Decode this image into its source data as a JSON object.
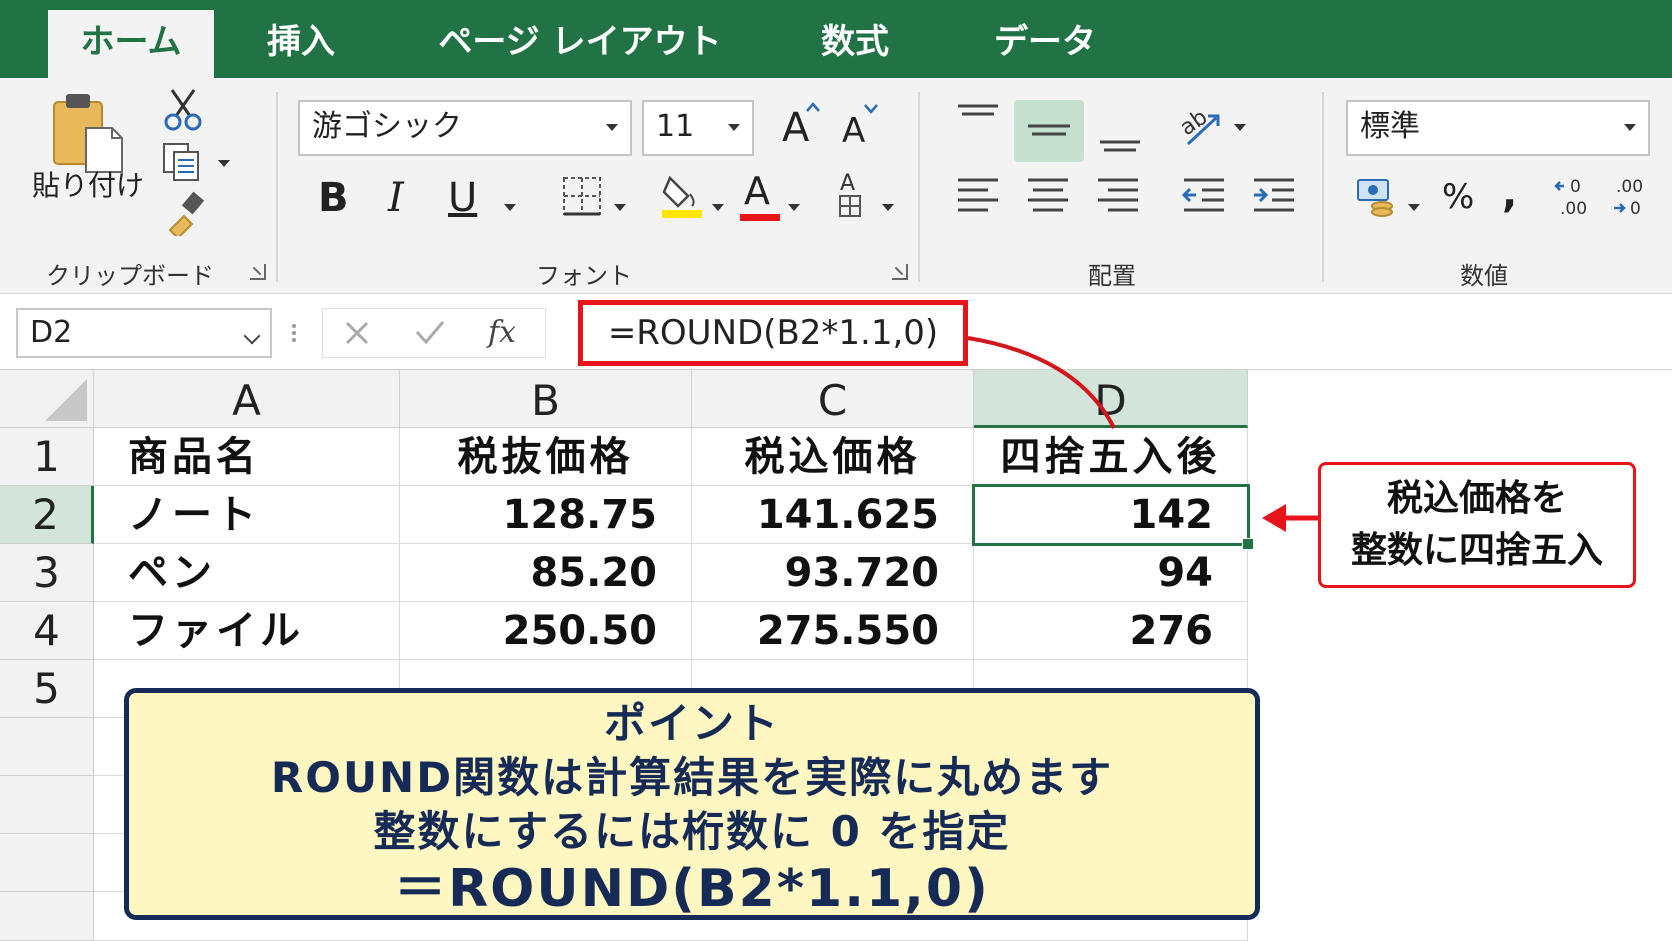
{
  "ribbon": {
    "tabs": [
      "ホーム",
      "挿入",
      "ページ レイアウト",
      "数式",
      "データ"
    ],
    "active_tab": "ホーム",
    "clipboard": {
      "paste_label": "貼り付け",
      "group_label": "クリップボード"
    },
    "font": {
      "font_name": "游ゴシック",
      "font_size": "11",
      "bold": "B",
      "italic": "I",
      "underline": "U",
      "grow": "A",
      "shrink": "A",
      "font_color_glyph": "A",
      "group_label": "フォント"
    },
    "alignment": {
      "group_label": "配置"
    },
    "number": {
      "format": "標準",
      "percent": "%",
      "comma": ",",
      "group_label": "数値"
    }
  },
  "formula_bar": {
    "name_box": "D2",
    "fx": "fx",
    "formula": "=ROUND(B2*1.1,0)"
  },
  "sheet": {
    "columns": [
      "A",
      "B",
      "C",
      "D"
    ],
    "rows": [
      "1",
      "2",
      "3",
      "4",
      "5"
    ],
    "cells": [
      [
        "商品名",
        "税抜価格",
        "税込価格",
        "四捨五入後"
      ],
      [
        "ノート",
        "128.75",
        "141.625",
        "142"
      ],
      [
        "ペン",
        "85.20",
        "93.720",
        "94"
      ],
      [
        "ファイル",
        "250.50",
        "275.550",
        "276"
      ]
    ],
    "active_cell": "D2"
  },
  "callout": {
    "line1": "税込価格を",
    "line2": "整数に四捨五入"
  },
  "point": {
    "title": "ポイント",
    "line1": "ROUND関数は計算結果を実際に丸めます",
    "line2": "整数にするには桁数に 0 を指定",
    "line3": "＝ROUND(B2*1.1,0)"
  },
  "colors": {
    "excel_green": "#217346",
    "callout_red": "#e8141c",
    "point_bg": "#fff7c2",
    "point_border": "#152a55"
  }
}
